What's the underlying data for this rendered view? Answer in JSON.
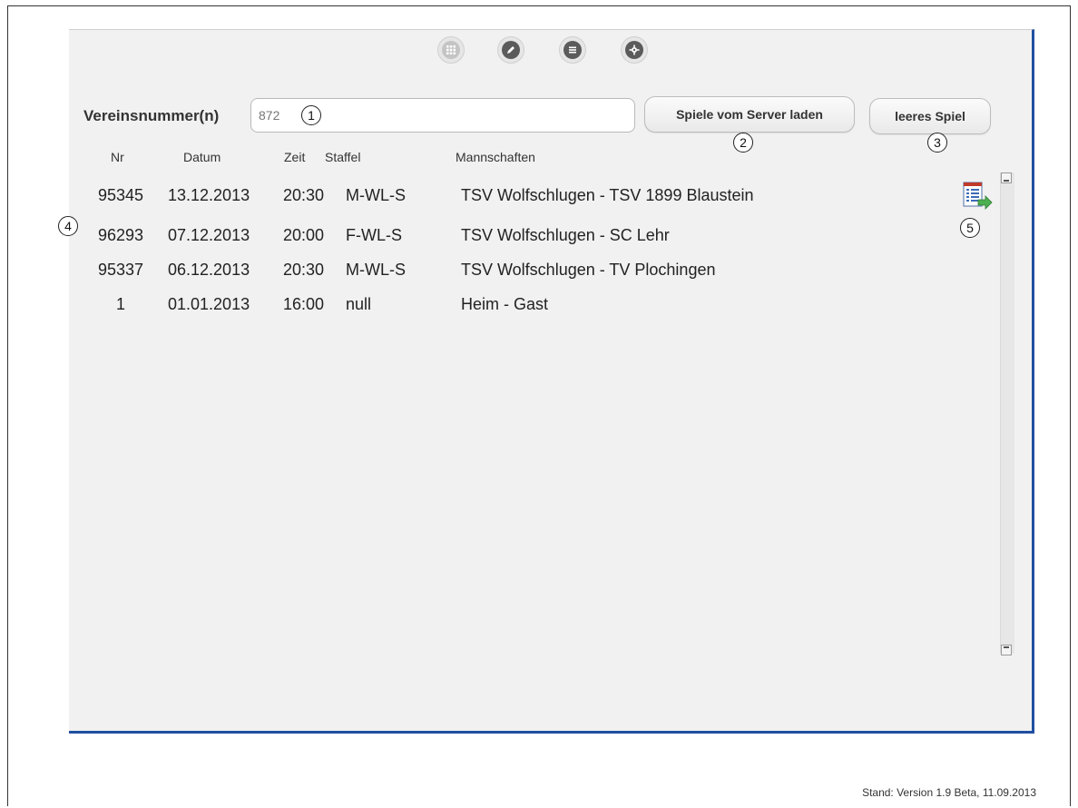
{
  "toolbar": {
    "icons": [
      "grid-icon",
      "pencil-icon",
      "list-icon",
      "gear-icon"
    ]
  },
  "vereinsnummer": {
    "label": "Vereinsnummer(n)",
    "value": "872"
  },
  "buttons": {
    "load_from_server": "Spiele vom Server laden",
    "empty_game": "leeres Spiel"
  },
  "table": {
    "headers": {
      "nr": "Nr",
      "datum": "Datum",
      "zeit": "Zeit",
      "staffel": "Staffel",
      "mannschaften": "Mannschaften"
    },
    "rows": [
      {
        "nr": "95345",
        "datum": "13.12.2013",
        "zeit": "20:30",
        "staffel": "M-WL-S",
        "mannschaften": "TSV Wolfschlugen - TSV 1899 Blaustein"
      },
      {
        "nr": "96293",
        "datum": "07.12.2013",
        "zeit": "20:00",
        "staffel": "F-WL-S",
        "mannschaften": "TSV Wolfschlugen - SC Lehr"
      },
      {
        "nr": "95337",
        "datum": "06.12.2013",
        "zeit": "20:30",
        "staffel": "M-WL-S",
        "mannschaften": "TSV Wolfschlugen - TV Plochingen"
      },
      {
        "nr": "1",
        "datum": "01.01.2013",
        "zeit": "16:00",
        "staffel": "null",
        "mannschaften": "Heim - Gast"
      }
    ]
  },
  "callouts": {
    "c1": "1",
    "c2": "2",
    "c3": "3",
    "c4": "4",
    "c5": "5"
  },
  "footer": {
    "stand": "Stand: Version 1.9 Beta, 11.09.2013"
  },
  "colors": {
    "panel_border": "#1f4fa0",
    "panel_background": "#f1f1f1"
  }
}
